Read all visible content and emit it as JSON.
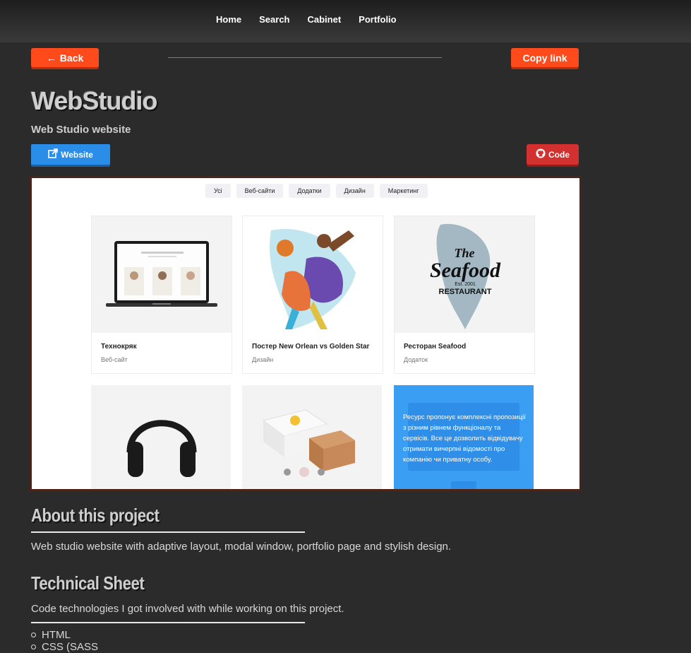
{
  "nav": [
    "Home",
    "Search",
    "Cabinet",
    "Portfolio"
  ],
  "back_label": "Back",
  "copy_label": "Copy link",
  "project": {
    "title": "WebStudio",
    "subtitle": "Web Studio website",
    "website_label": "Website",
    "code_label": "Code"
  },
  "preview": {
    "filters": [
      "Усі",
      "Веб-сайти",
      "Додатки",
      "Дизайн",
      "Маркетинг"
    ],
    "cards": [
      {
        "title": "Технокряк",
        "category": "Веб-сайт"
      },
      {
        "title": "Постер New Orlean vs Golden Star",
        "category": "Дизайн"
      },
      {
        "title": "Ресторан Seafood",
        "category": "Додаток"
      }
    ],
    "seafood_logo": {
      "the": "The",
      "name": "Seafood",
      "est": "Est. 2001",
      "restaurant": "RESTAURANT"
    },
    "overlay_text": "Ресурс пропонує комплексні пропозиції з різним рівнем функціоналу та сервісів. Все це дозволить відвідувачу отримати вичерпні відомості про компанію чи приватну особу."
  },
  "about": {
    "heading": "About this project",
    "text": "Web studio website with adaptive layout, modal window, portfolio page and stylish design."
  },
  "tech": {
    "heading": "Technical Sheet",
    "text": "Code technologies I got involved with while working on this project.",
    "items": [
      "HTML",
      "CSS (SASS"
    ]
  },
  "colors": {
    "accent": "#ff4a1c",
    "website": "#2a8ee8",
    "code": "#d3312f",
    "bg": "#2b2b2b"
  }
}
